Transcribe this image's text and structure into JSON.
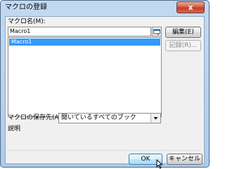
{
  "window": {
    "title": "マクロの登録",
    "close_label": "x"
  },
  "macro_name": {
    "label": "マクロ名(M):",
    "value": "Macro1",
    "collapse_icon": "range-select-icon"
  },
  "macro_list": {
    "items": [
      "Macro1"
    ],
    "selected_index": 0
  },
  "buttons": {
    "edit": "編集(E)",
    "record": "記録(R)...",
    "ok": "OK",
    "cancel": "キャンセル"
  },
  "save_location": {
    "label": "マクロの保存先(A):",
    "value": "開いているすべてのブック"
  },
  "description": {
    "label": "説明"
  },
  "colors": {
    "selection": "#3399ff",
    "window_frame": "#c3d9f1",
    "close_button": "#c23b22"
  }
}
